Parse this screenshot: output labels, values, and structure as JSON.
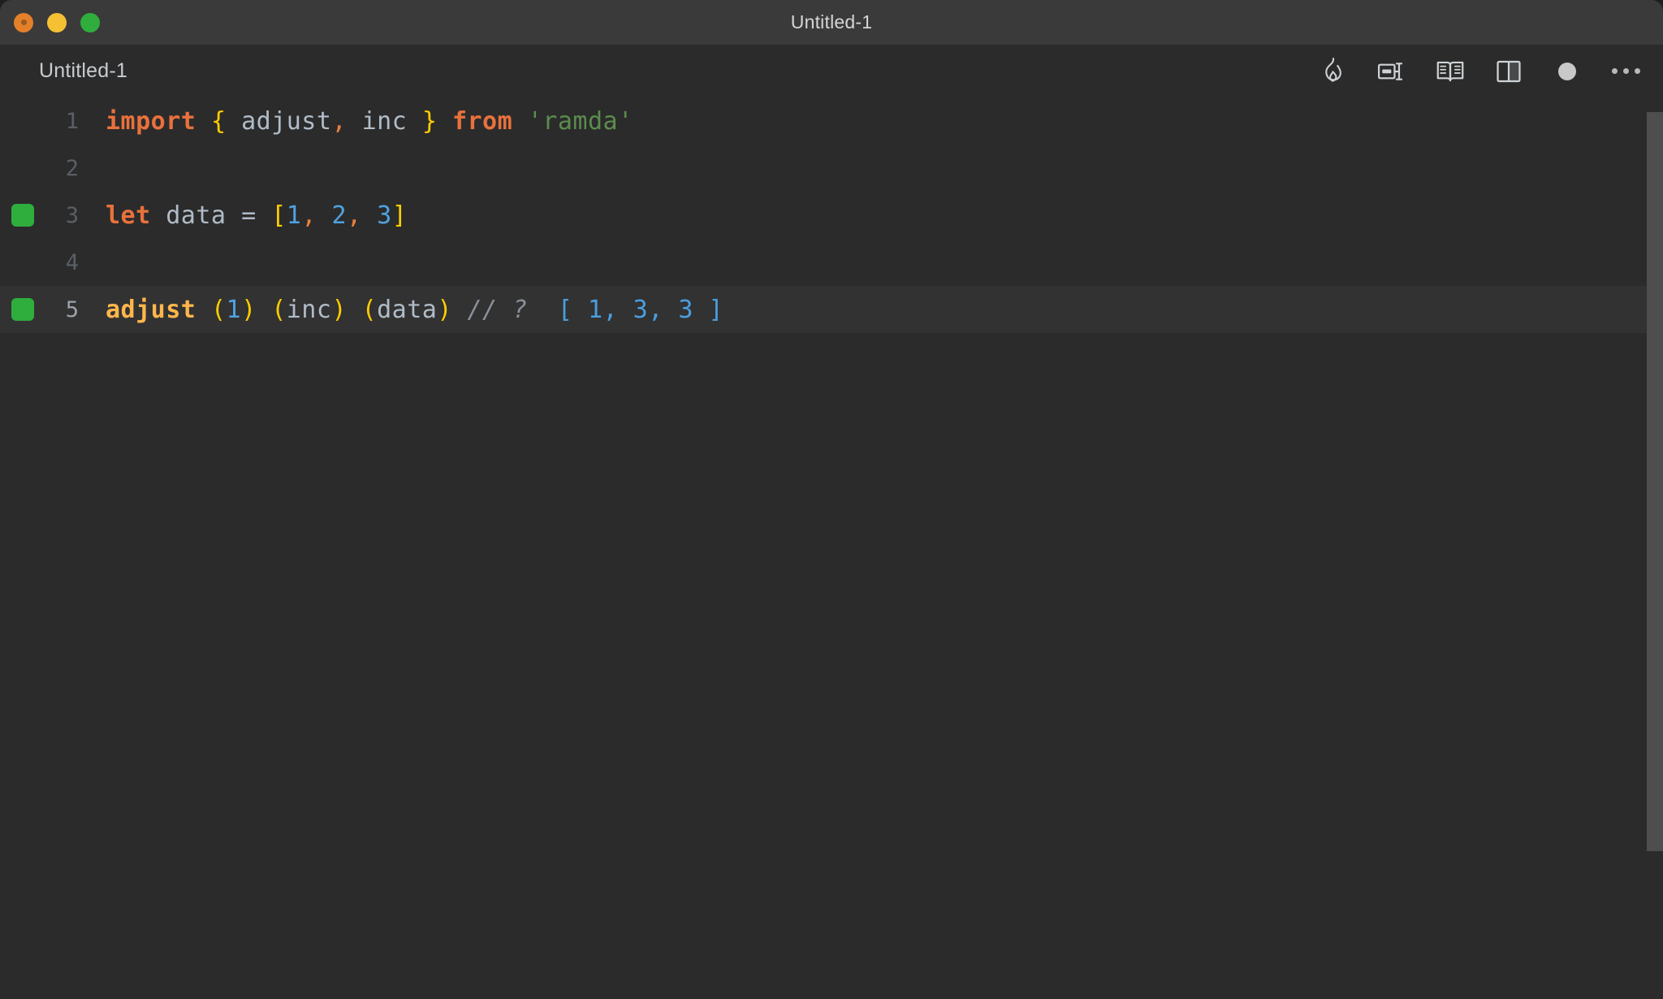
{
  "window": {
    "title": "Untitled-1",
    "traffic_lights": [
      {
        "name": "close",
        "color": "#e4802a"
      },
      {
        "name": "minimize",
        "color": "#f5c033"
      },
      {
        "name": "maximize",
        "color": "#2fae3e"
      }
    ]
  },
  "tab": {
    "label": "Untitled-1",
    "dirty": true
  },
  "toolbar": {
    "items": [
      {
        "icon": "flame-icon",
        "title": "Start Quokka"
      },
      {
        "icon": "run-code-icon",
        "title": "Run Code"
      },
      {
        "icon": "open-book-icon",
        "title": "Open Preview"
      },
      {
        "icon": "split-editor-icon",
        "title": "Split Editor Right"
      },
      {
        "icon": "unsaved-dot-icon",
        "title": "Unsaved changes"
      },
      {
        "icon": "ellipsis-icon",
        "title": "More Actions..."
      }
    ]
  },
  "editor": {
    "language": "javascript",
    "active_line": 5,
    "lines": [
      {
        "number": "1",
        "marker": false,
        "active": false,
        "tokens": [
          {
            "t": "import",
            "c": "kw"
          },
          {
            "t": " ",
            "c": "plain"
          },
          {
            "t": "{",
            "c": "brace"
          },
          {
            "t": " ",
            "c": "plain"
          },
          {
            "t": "adjust",
            "c": "ident"
          },
          {
            "t": ",",
            "c": "punc"
          },
          {
            "t": " ",
            "c": "plain"
          },
          {
            "t": "inc",
            "c": "ident"
          },
          {
            "t": " ",
            "c": "plain"
          },
          {
            "t": "}",
            "c": "brace"
          },
          {
            "t": " ",
            "c": "plain"
          },
          {
            "t": "from",
            "c": "kw"
          },
          {
            "t": " ",
            "c": "plain"
          },
          {
            "t": "'ramda'",
            "c": "str"
          }
        ]
      },
      {
        "number": "2",
        "marker": false,
        "active": false,
        "tokens": []
      },
      {
        "number": "3",
        "marker": true,
        "active": false,
        "tokens": [
          {
            "t": "let",
            "c": "kw"
          },
          {
            "t": " ",
            "c": "plain"
          },
          {
            "t": "data",
            "c": "ident"
          },
          {
            "t": " ",
            "c": "plain"
          },
          {
            "t": "=",
            "c": "ident"
          },
          {
            "t": " ",
            "c": "plain"
          },
          {
            "t": "[",
            "c": "brace"
          },
          {
            "t": "1",
            "c": "num"
          },
          {
            "t": ",",
            "c": "punc"
          },
          {
            "t": " ",
            "c": "plain"
          },
          {
            "t": "2",
            "c": "num"
          },
          {
            "t": ",",
            "c": "punc"
          },
          {
            "t": " ",
            "c": "plain"
          },
          {
            "t": "3",
            "c": "num"
          },
          {
            "t": "]",
            "c": "brace"
          }
        ]
      },
      {
        "number": "4",
        "marker": false,
        "active": false,
        "tokens": []
      },
      {
        "number": "5",
        "marker": true,
        "active": true,
        "tokens": [
          {
            "t": "adjust",
            "c": "func"
          },
          {
            "t": " ",
            "c": "plain"
          },
          {
            "t": "(",
            "c": "brace"
          },
          {
            "t": "1",
            "c": "num"
          },
          {
            "t": ")",
            "c": "brace"
          },
          {
            "t": " ",
            "c": "plain"
          },
          {
            "t": "(",
            "c": "brace"
          },
          {
            "t": "inc",
            "c": "ident"
          },
          {
            "t": ")",
            "c": "brace"
          },
          {
            "t": " ",
            "c": "plain"
          },
          {
            "t": "(",
            "c": "brace"
          },
          {
            "t": "data",
            "c": "ident"
          },
          {
            "t": ")",
            "c": "brace"
          },
          {
            "t": " ",
            "c": "plain"
          },
          {
            "t": "// ?",
            "c": "comment"
          },
          {
            "t": "  ",
            "c": "plain"
          },
          {
            "t": "[ 1, 3, 3 ]",
            "c": "quokka"
          }
        ]
      }
    ]
  },
  "scrollbar": {
    "visible": true
  },
  "colors": {
    "background": "#2b2b2b",
    "titlebar": "#3a3a3a",
    "active_line": "#323232",
    "keyword": "#e8713c",
    "brace": "#ffcc00",
    "identifier": "#b0bcc8",
    "string": "#5b8c4e",
    "number": "#4fa3e0",
    "function": "#ffb64c",
    "comment": "#8a9099",
    "quokka_result": "#4a9fe0",
    "gutter_marker": "#2fae3e",
    "linenum": "#5a5f66",
    "linenum_active": "#9aa2ab",
    "scrollbar_thumb": "#4e4e4e"
  }
}
